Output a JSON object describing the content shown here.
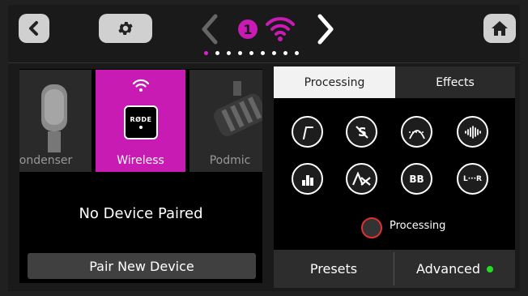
{
  "header": {
    "channel_number": "1",
    "page_dots": 9,
    "active_dot": 0,
    "icons": {
      "back": "chevron-left-icon",
      "settings": "gear-icon",
      "prev": "chevron-left-icon",
      "wireless": "wifi-icon",
      "next": "chevron-right-icon",
      "home": "home-icon"
    }
  },
  "devices": {
    "items": [
      {
        "label": "Condenser",
        "icon": "microphone-icon"
      },
      {
        "label": "Wireless",
        "icon": "wifi-icon",
        "badge": "RØDE"
      },
      {
        "label": "Podmic",
        "icon": "podmic-icon"
      }
    ],
    "status": "No Device Paired",
    "pair_button": "Pair New Device"
  },
  "right_panel": {
    "tabs": [
      {
        "label": "Processing",
        "selected": true
      },
      {
        "label": "Effects",
        "selected": false
      }
    ],
    "effects": [
      {
        "name": "high-pass-filter-icon"
      },
      {
        "name": "de-esser-icon"
      },
      {
        "name": "noise-gate-icon"
      },
      {
        "name": "compressor-icon"
      },
      {
        "name": "eq-icon"
      },
      {
        "name": "aphex-icon"
      },
      {
        "label": "BB"
      },
      {
        "label": "L···R"
      }
    ],
    "processing_label": "Processing",
    "presets_label": "Presets",
    "advanced_label": "Advanced"
  },
  "colors": {
    "accent": "#c71bb4",
    "background": "#1a1a1a",
    "status_green": "#22dd22",
    "toggle_ring": "#e03030"
  }
}
